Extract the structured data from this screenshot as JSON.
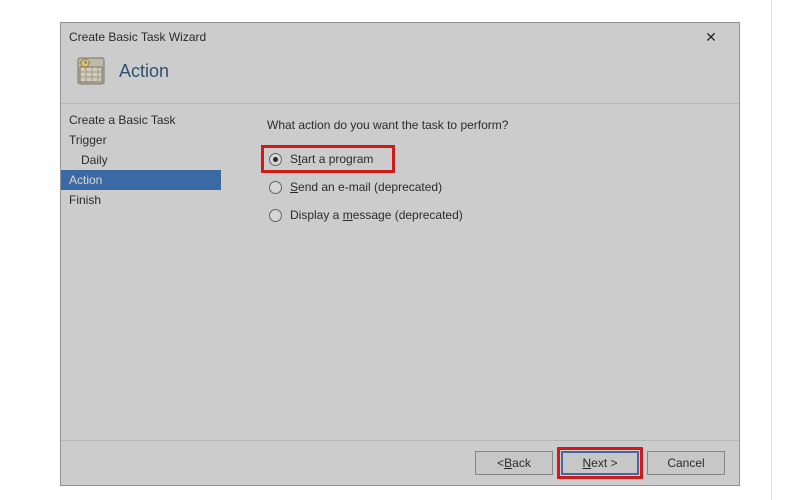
{
  "window": {
    "title": "Create Basic Task Wizard",
    "close_glyph": "✕"
  },
  "header": {
    "heading": "Action"
  },
  "sidebar": {
    "items": [
      {
        "label": "Create a Basic Task",
        "indent": false,
        "selected": false
      },
      {
        "label": "Trigger",
        "indent": false,
        "selected": false
      },
      {
        "label": "Daily",
        "indent": true,
        "selected": false
      },
      {
        "label": "Action",
        "indent": false,
        "selected": true
      },
      {
        "label": "Finish",
        "indent": false,
        "selected": false
      }
    ]
  },
  "main": {
    "prompt": "What action do you want the task to perform?",
    "options": [
      {
        "pre": "S",
        "key": "t",
        "post": "art a program",
        "selected": true,
        "highlighted": true
      },
      {
        "pre": "",
        "key": "S",
        "post": "end an e-mail (deprecated)",
        "selected": false,
        "highlighted": false
      },
      {
        "pre": "Display a ",
        "key": "m",
        "post": "essage (deprecated)",
        "selected": false,
        "highlighted": false
      }
    ]
  },
  "footer": {
    "back_pre": "< ",
    "back_key": "B",
    "back_post": "ack",
    "next_pre": "",
    "next_key": "N",
    "next_post": "ext >",
    "next_highlighted": true,
    "cancel": "Cancel"
  }
}
